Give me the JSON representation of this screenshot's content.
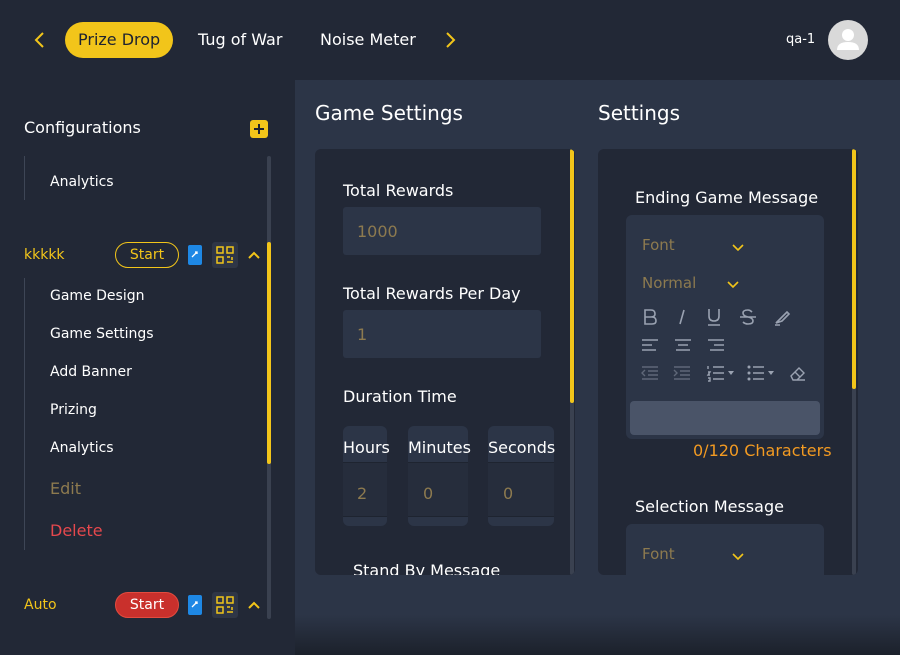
{
  "topbar": {
    "tabs": [
      {
        "label": "Prize Drop",
        "active": true
      },
      {
        "label": "Tug of War",
        "active": false
      },
      {
        "label": "Noise Meter",
        "active": false
      }
    ],
    "user_name": "qa-1"
  },
  "sidebar": {
    "title": "Configurations",
    "first_items": [
      "Analytics"
    ],
    "games": [
      {
        "name": "kkkkk",
        "start_label": "Start",
        "expanded": true,
        "items": [
          "Game Design",
          "Game Settings",
          "Add Banner",
          "Prizing",
          "Analytics"
        ],
        "edit_label": "Edit",
        "delete_label": "Delete"
      },
      {
        "name": "Auto",
        "start_label": "Start",
        "active": true
      }
    ]
  },
  "game_settings": {
    "title": "Game Settings",
    "total_rewards_label": "Total Rewards",
    "total_rewards_value": "1000",
    "per_day_label": "Total Rewards Per Day",
    "per_day_value": "1",
    "duration_label": "Duration Time",
    "hours_label": "Hours",
    "hours_value": "2",
    "minutes_label": "Minutes",
    "minutes_value": "0",
    "seconds_label": "Seconds",
    "seconds_value": "0",
    "standby_label": "Stand By Message"
  },
  "settings": {
    "title": "Settings",
    "ending_label": "Ending Game Message",
    "font_placeholder": "Font",
    "size_placeholder": "Normal",
    "char_count": "0/120 Characters",
    "selection_label": "Selection Message",
    "font_placeholder_2": "Font"
  },
  "colors": {
    "accent": "#f2c51a",
    "bg": "#222836",
    "panel": "#2c3547",
    "danger": "#e5484d",
    "counter": "#f29a22"
  }
}
